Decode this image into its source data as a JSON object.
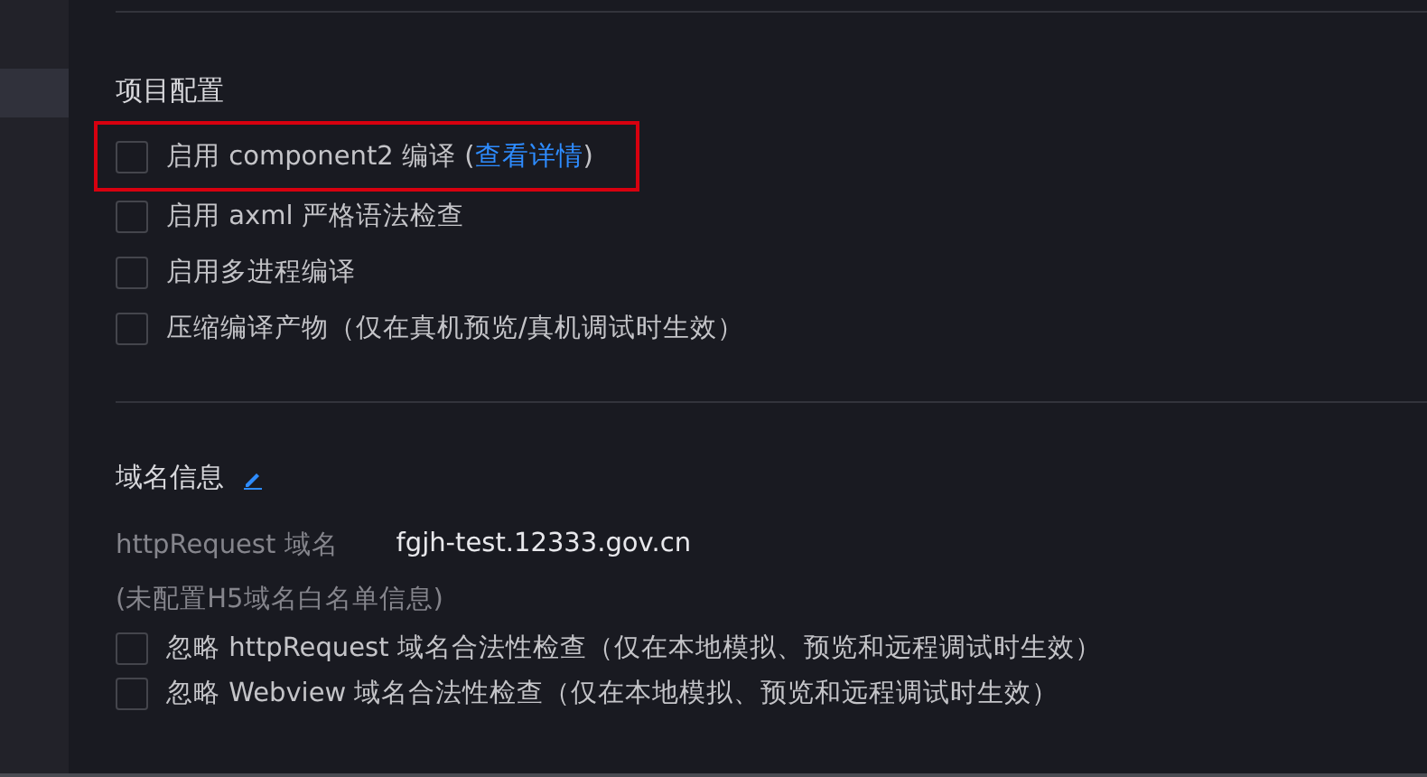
{
  "sidebar": {
    "items": [
      {
        "selected": true
      }
    ]
  },
  "project_config": {
    "title": "项目配置",
    "options": [
      {
        "label": "启用 component2 编译 (",
        "link": "查看详情",
        "suffix": ")",
        "checked": false,
        "highlighted": true
      },
      {
        "label": "启用 axml 严格语法检查",
        "checked": false,
        "highlighted": false
      },
      {
        "label": "启用多进程编译",
        "checked": false,
        "highlighted": false
      },
      {
        "label": "压缩编译产物（仅在真机预览/真机调试时生效）",
        "checked": false,
        "highlighted": false
      }
    ]
  },
  "domain_info": {
    "title": "域名信息",
    "fields": [
      {
        "label": "httpRequest 域名",
        "value": "fgjh-test.12333.gov.cn"
      }
    ],
    "note": "(未配置H5域名白名单信息)",
    "options": [
      {
        "label": "忽略 httpRequest 域名合法性检查（仅在本地模拟、预览和远程调试时生效）",
        "checked": false
      },
      {
        "label": "忽略 Webview 域名合法性检查（仅在本地模拟、预览和远程调试时生效）",
        "checked": false
      }
    ]
  }
}
